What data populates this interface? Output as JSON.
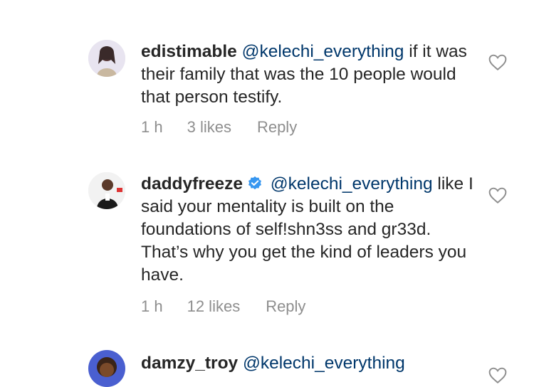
{
  "cut_top_text": "",
  "comments": [
    {
      "username": "edistimable",
      "verified": false,
      "mention": "@kelechi_everything",
      "text": "if it was their family that was the 10 people would that person testify.",
      "time": "1 h",
      "likes": "3 likes",
      "reply": "Reply",
      "avatar_icon": "avatar-woman-icon",
      "like_icon": "heart-outline-icon"
    },
    {
      "username": "daddyfreeze",
      "verified": true,
      "mention": "@kelechi_everything",
      "text": "like I said your mentality is built on the foundations of self!shn3ss and gr33d. That’s why you get the kind of leaders you have.",
      "time": "1 h",
      "likes": "12 likes",
      "reply": "Reply",
      "avatar_icon": "avatar-man-icon",
      "like_icon": "heart-outline-icon"
    },
    {
      "username": "damzy_troy",
      "verified": false,
      "mention": "@kelechi_everything",
      "text": "",
      "time": "",
      "likes": "",
      "reply": "",
      "avatar_icon": "avatar-cartoon-icon",
      "like_icon": "heart-outline-icon"
    }
  ],
  "colors": {
    "text": "#262626",
    "mention": "#00376b",
    "meta": "#8e8e8e",
    "verified": "#3897f0"
  }
}
